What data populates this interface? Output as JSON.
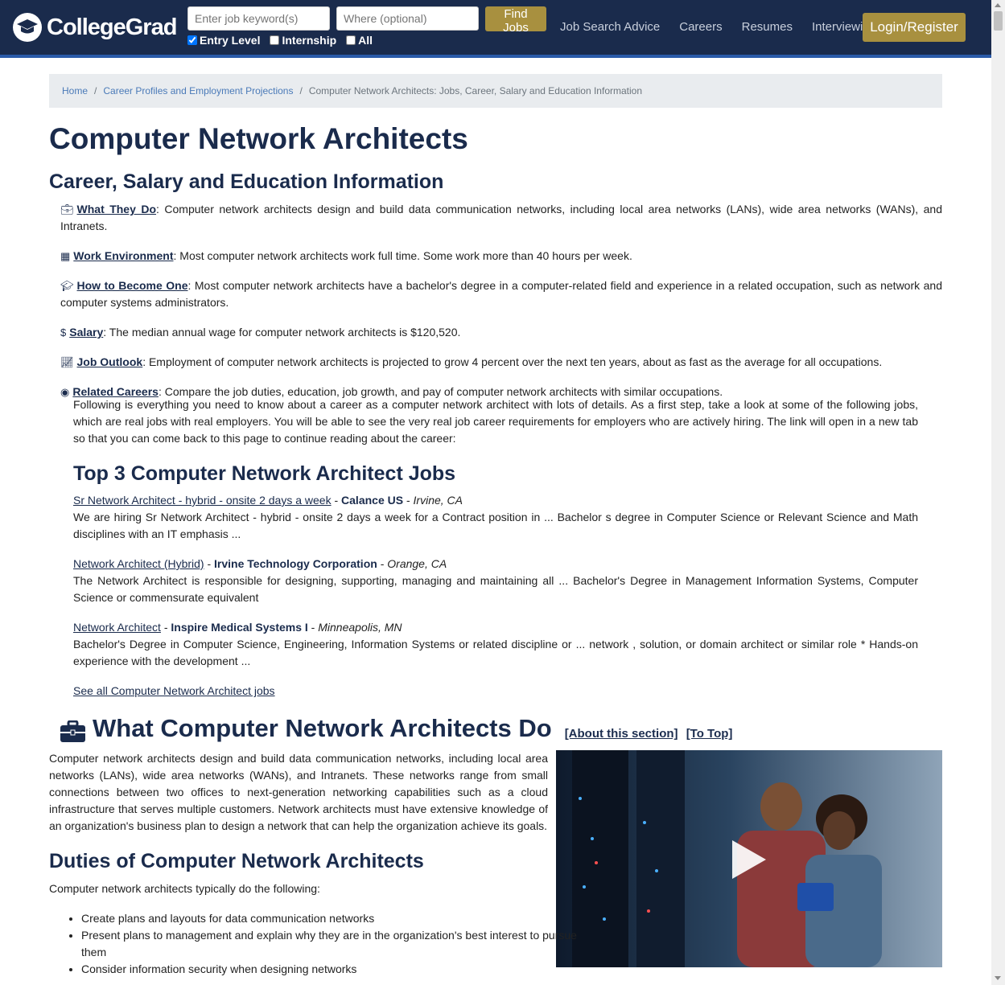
{
  "header": {
    "logo_text": "CollegeGrad",
    "search_keyword_placeholder": "Enter job keyword(s)",
    "search_where_placeholder": "Where (optional)",
    "find_button": "Find Jobs",
    "filters": [
      {
        "label": "Entry Level",
        "checked": true
      },
      {
        "label": "Internship",
        "checked": false
      },
      {
        "label": "All",
        "checked": false
      }
    ],
    "nav": [
      "Job Search Advice",
      "Careers",
      "Resumes",
      "Interviewing"
    ],
    "login": "Login/Register",
    "colors": {
      "navbar": "#1a2b4c",
      "accent": "#a8903f",
      "underline": "#2a5aa8"
    }
  },
  "breadcrumb": {
    "home": "Home",
    "profiles": "Career Profiles and Employment Projections",
    "current": "Computer Network Architects: Jobs, Career, Salary and Education Information"
  },
  "page": {
    "title": "Computer Network Architects",
    "subtitle": "Career, Salary and Education Information"
  },
  "summary": {
    "what_label": "What They Do",
    "what_text": ": Computer network architects design and build data communication networks, including local area networks (LANs), wide area networks (WANs), and Intranets.",
    "env_label": "Work Environment",
    "env_text": ": Most computer network architects work full time. Some work more than 40 hours per week.",
    "become_label": "How to Become One",
    "become_text": ": Most computer network architects have a bachelor's degree in a computer-related field and experience in a related occupation, such as network and computer systems administrators.",
    "salary_label": "Salary",
    "salary_text": ": The median annual wage for computer network architects is $120,520.",
    "outlook_label": "Job Outlook",
    "outlook_text": ": Employment of computer network architects is projected to grow 4 percent over the next ten years, about as fast as the average for all occupations.",
    "related_label": "Related Careers",
    "related_text": ": Compare the job duties, education, job growth, and pay of computer network architects with similar occupations."
  },
  "intro": "Following is everything you need to know about a career as a computer network architect with lots of details. As a first step, take a look at some of the following jobs, which are real jobs with real employers. You will be able to see the very real job career requirements for employers who are actively hiring. The link will open in a new tab so that you can come back to this page to continue reading about the career:",
  "jobs": {
    "title": "Top 3 Computer Network Architect Jobs",
    "items": [
      {
        "title": "Sr Network Architect - hybrid - onsite 2 days a week",
        "company": "Calance US",
        "location": "Irvine, CA",
        "desc": "We are hiring Sr Network Architect - hybrid - onsite 2 days a week for a Contract position in ... Bachelor s degree in Computer Science or Relevant Science and Math disciplines with an IT emphasis ..."
      },
      {
        "title": "Network Architect (Hybrid)",
        "company": "Irvine Technology Corporation",
        "location": "Orange, CA",
        "desc": "The Network Architect is responsible for designing, supporting, managing and maintaining all ... Bachelor's Degree in Management Information Systems, Computer Science or commensurate equivalent"
      },
      {
        "title": "Network Architect",
        "company": "Inspire Medical Systems I",
        "location": "Minneapolis, MN",
        "desc": "Bachelor's Degree in Computer Science, Engineering, Information Systems or related discipline or ... network , solution, or domain architect or similar role * Hands-on experience with the development ..."
      }
    ],
    "see_all": "See all Computer Network Architect jobs"
  },
  "what": {
    "title": "What Computer Network Architects Do",
    "about_link": "[About this section]",
    "top_link": "[To Top]",
    "text": "Computer network architects design and build data communication networks, including local area networks (LANs), wide area networks (WANs), and Intranets. These networks range from small connections between two offices to next-generation networking capabilities such as a cloud infrastructure that serves multiple customers. Network architects must have extensive knowledge of an organization's business plan to design a network that can help the organization achieve its goals."
  },
  "duties": {
    "title": "Duties of Computer Network Architects",
    "intro": "Computer network architects typically do the following:",
    "items": [
      "Create plans and layouts for data communication networks",
      "Present plans to management and explain why they are in the organization's best interest to pursue them",
      "Consider information security when designing networks"
    ]
  }
}
